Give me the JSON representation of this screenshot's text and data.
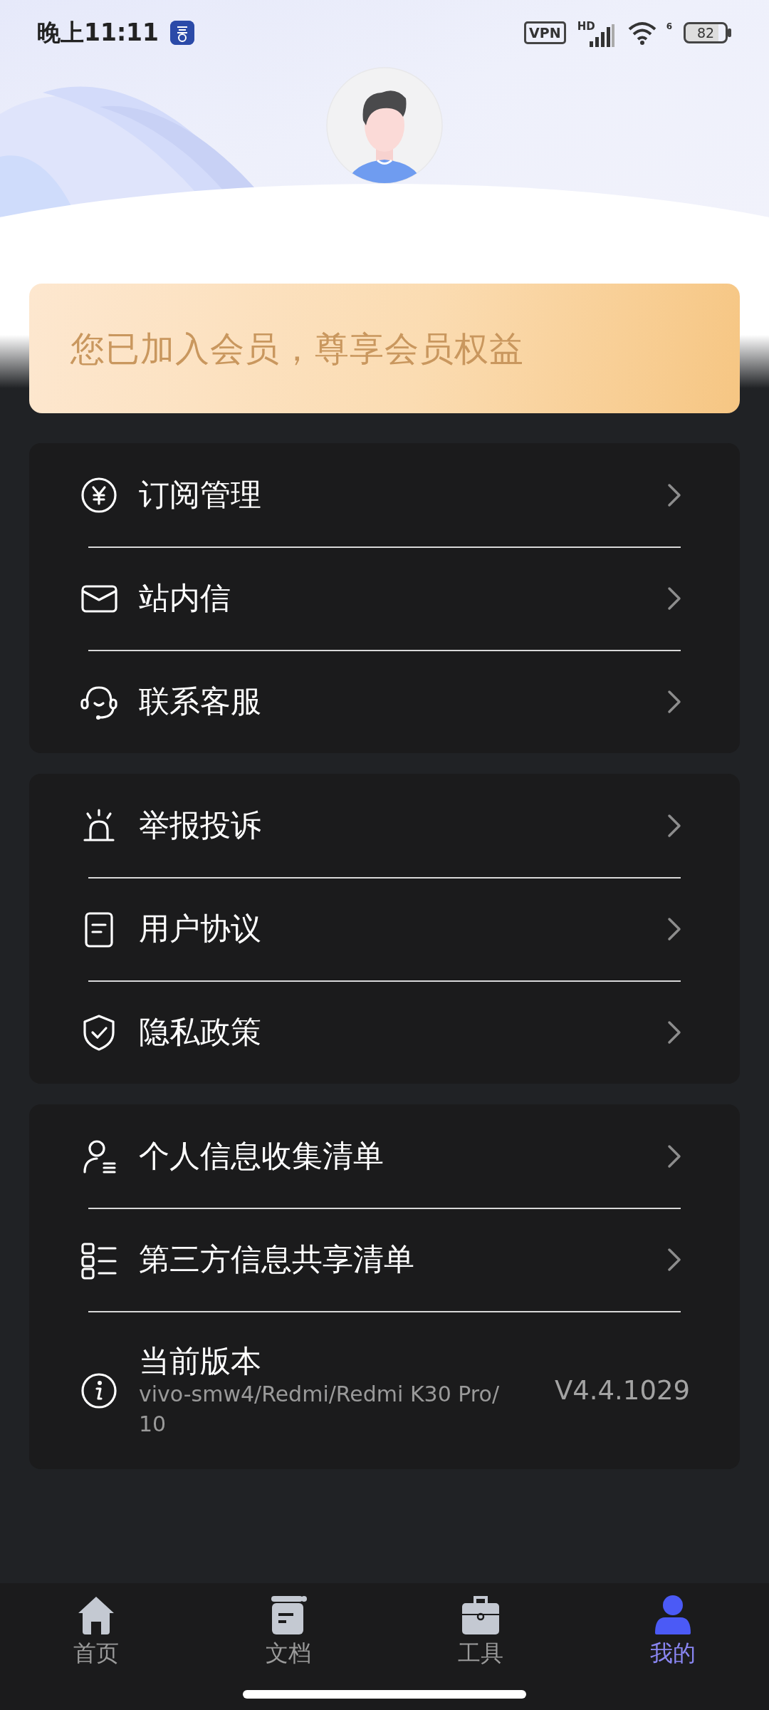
{
  "status_bar": {
    "time": "晚上11:11",
    "vpn": "VPN",
    "network": "HD",
    "wifi": "6",
    "battery": "82"
  },
  "member_banner": {
    "text": "您已加入会员，尊享会员权益"
  },
  "menu_groups": [
    {
      "items": [
        {
          "kind": "link",
          "label": "订阅管理"
        },
        {
          "kind": "link",
          "label": "站内信"
        },
        {
          "kind": "link",
          "label": "联系客服"
        }
      ]
    },
    {
      "items": [
        {
          "kind": "link",
          "label": "举报投诉"
        },
        {
          "kind": "link",
          "label": "用户协议"
        },
        {
          "kind": "link",
          "label": "隐私政策"
        }
      ]
    },
    {
      "items": [
        {
          "kind": "link",
          "label": "个人信息收集清单"
        },
        {
          "kind": "link",
          "label": "第三方信息共享清单"
        },
        {
          "kind": "version",
          "label": "当前版本",
          "detail": "vivo-smw4/Redmi/Redmi K30 Pro/10",
          "value": "V4.4.1029"
        }
      ]
    }
  ],
  "tabs": [
    {
      "label": "首页",
      "selected": false
    },
    {
      "label": "文档",
      "selected": false
    },
    {
      "label": "工具",
      "selected": false
    },
    {
      "label": "我的",
      "selected": true
    }
  ]
}
